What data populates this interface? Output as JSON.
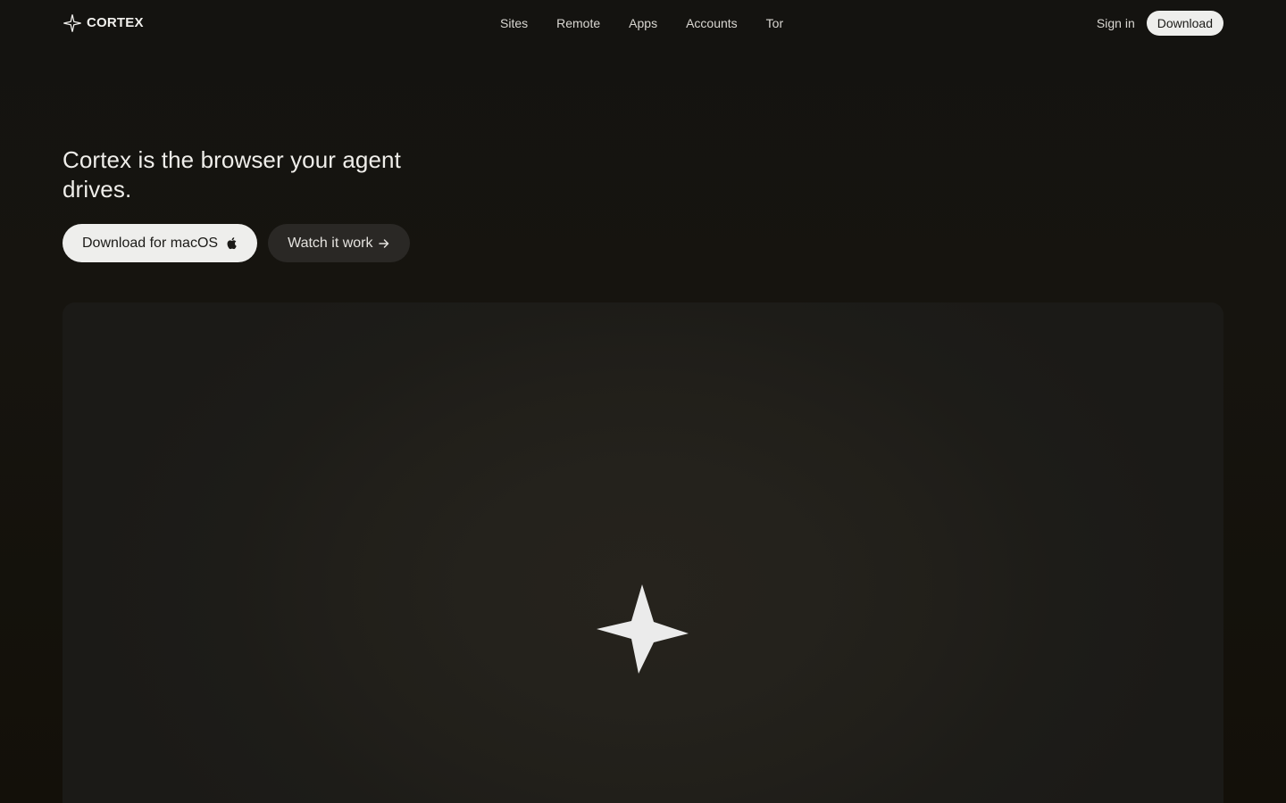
{
  "brand": {
    "name": "CORTEX",
    "icon": "sparkle-outline-icon"
  },
  "nav": {
    "links": [
      "Sites",
      "Remote",
      "Apps",
      "Accounts",
      "Tor"
    ],
    "sign_in": "Sign in",
    "download": "Download"
  },
  "hero": {
    "title": "Cortex is the browser your agent drives.",
    "primary_cta": "Download for macOS",
    "primary_cta_icon": "apple-icon",
    "secondary_cta": "Watch it work",
    "secondary_cta_icon": "arrow-right-icon"
  },
  "media": {
    "icon": "four-point-star-icon"
  },
  "colors": {
    "background": "#141310",
    "panel": "#24221c",
    "button_light": "#eeeeec",
    "button_dark": "#2a2825",
    "text": "#efeeea"
  }
}
